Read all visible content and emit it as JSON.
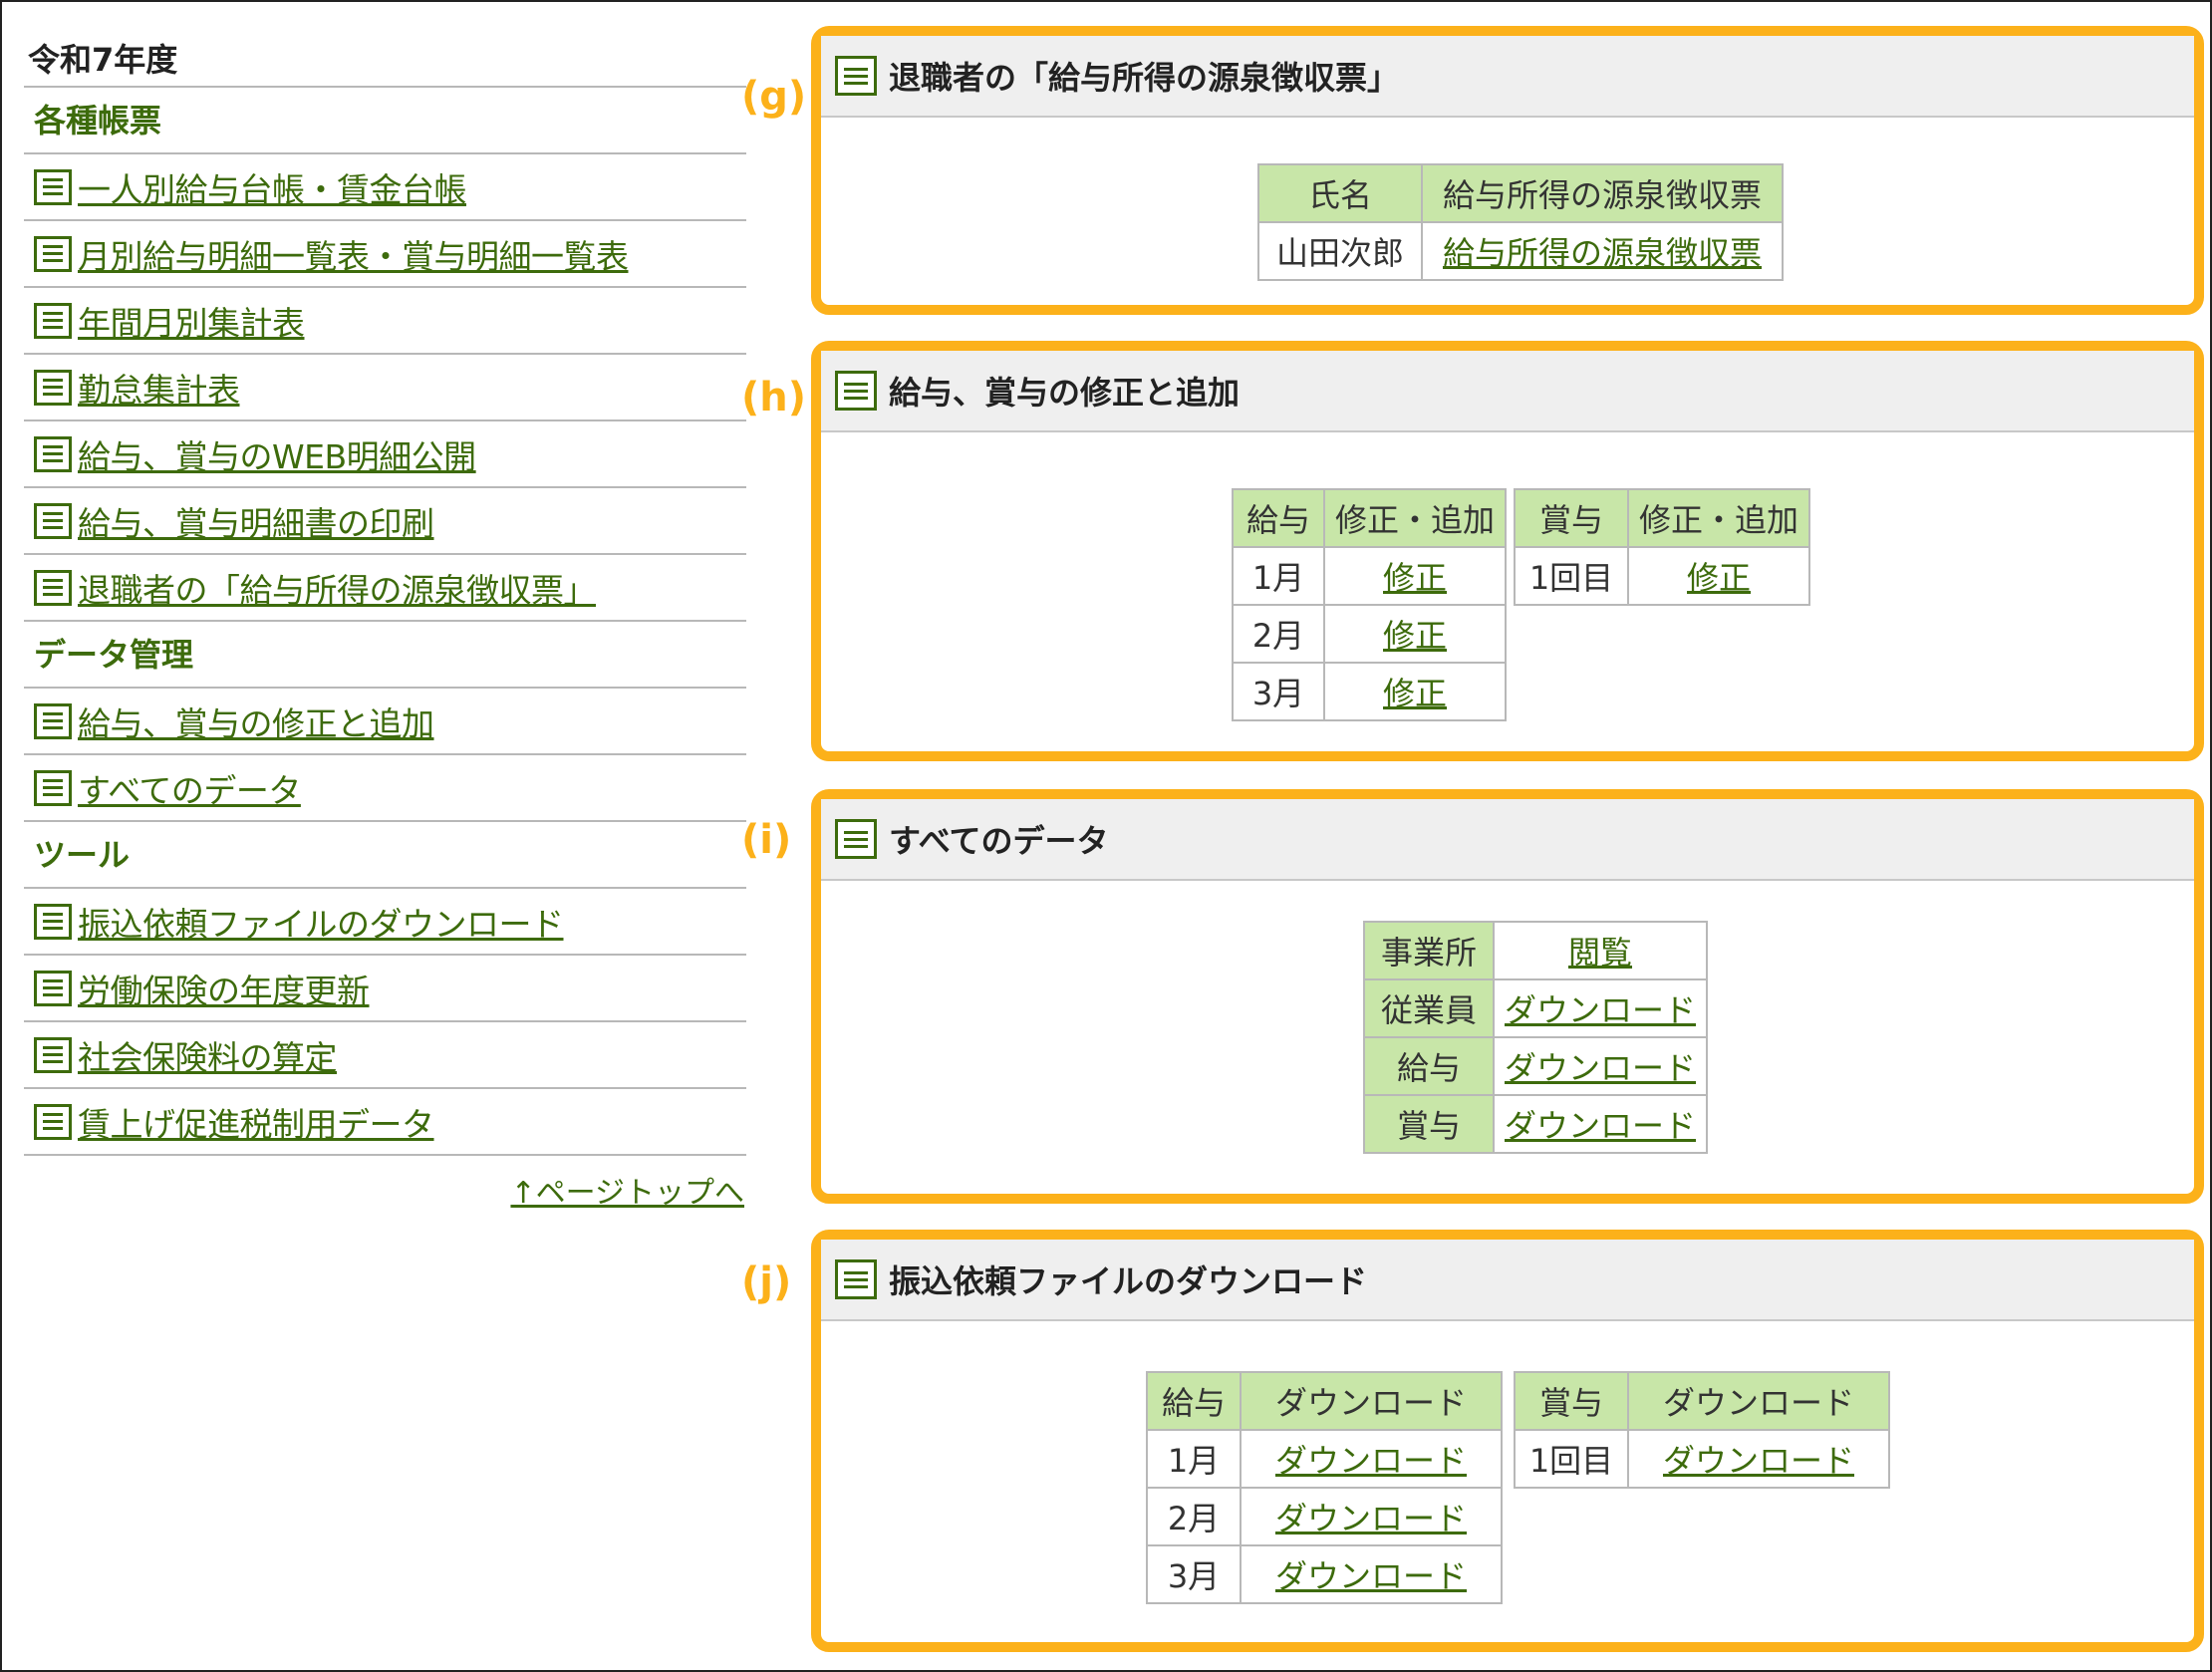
{
  "sidebar": {
    "year": "令和7年度",
    "sections": [
      {
        "title": "各種帳票",
        "items": [
          "一人別給与台帳・賃金台帳",
          "月別給与明細一覧表・賞与明細一覧表",
          "年間月別集計表",
          "勤怠集計表",
          "給与、賞与のWEB明細公開",
          "給与、賞与明細書の印刷",
          "退職者の「給与所得の源泉徴収票」"
        ]
      },
      {
        "title": "データ管理",
        "items": [
          "給与、賞与の修正と追加",
          "すべてのデータ"
        ]
      },
      {
        "title": "ツール",
        "items": [
          "振込依頼ファイルのダウンロード",
          "労働保険の年度更新",
          "社会保険料の算定",
          "賃上げ促進税制用データ"
        ]
      }
    ],
    "page_top": "↑ページトップへ"
  },
  "panels": {
    "g": {
      "marker": "(g)",
      "title": "退職者の「給与所得の源泉徴収票」",
      "headers": [
        "氏名",
        "給与所得の源泉徴収票"
      ],
      "rows": [
        [
          "山田次郎",
          "給与所得の源泉徴収票"
        ]
      ]
    },
    "h": {
      "marker": "(h)",
      "title": "給与、賞与の修正と追加",
      "salary_headers": [
        "給与",
        "修正・追加"
      ],
      "salary_rows": [
        [
          "1月",
          "修正"
        ],
        [
          "2月",
          "修正"
        ],
        [
          "3月",
          "修正"
        ]
      ],
      "bonus_headers": [
        "賞与",
        "修正・追加"
      ],
      "bonus_rows": [
        [
          "1回目",
          "修正"
        ]
      ]
    },
    "i": {
      "marker": "(i)",
      "title": "すべてのデータ",
      "rows": [
        [
          "事業所",
          "閲覧"
        ],
        [
          "従業員",
          "ダウンロード"
        ],
        [
          "給与",
          "ダウンロード"
        ],
        [
          "賞与",
          "ダウンロード"
        ]
      ]
    },
    "j": {
      "marker": "(j)",
      "title": "振込依頼ファイルのダウンロード",
      "salary_headers": [
        "給与",
        "ダウンロード"
      ],
      "salary_rows": [
        [
          "1月",
          "ダウンロード"
        ],
        [
          "2月",
          "ダウンロード"
        ],
        [
          "3月",
          "ダウンロード"
        ]
      ],
      "bonus_headers": [
        "賞与",
        "ダウンロード"
      ],
      "bonus_rows": [
        [
          "1回目",
          "ダウンロード"
        ]
      ]
    }
  },
  "colors": {
    "accent_green": "#3d6b0c",
    "header_green": "#c8e6a8",
    "highlight_orange": "#fcb11a"
  }
}
